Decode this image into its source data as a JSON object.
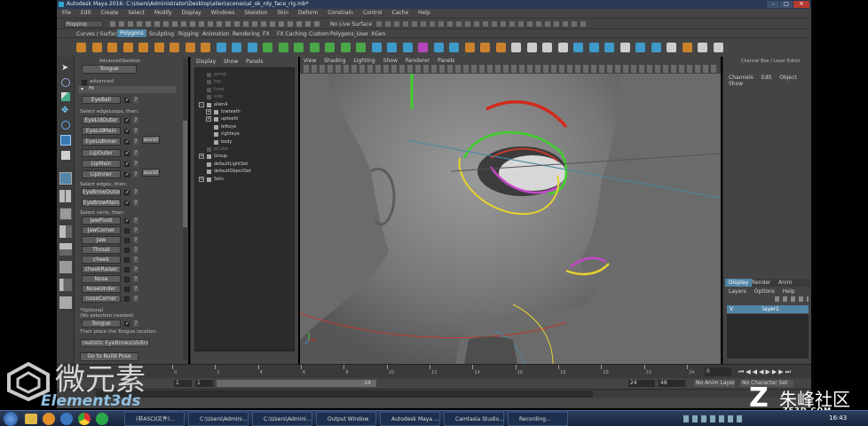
{
  "window": {
    "title": "Autodesk Maya 2016: C:\\Users\\Administrator\\Desktop\\alien\\scenes\\al_ok_rdy_face_rig.mb*"
  },
  "menubar": {
    "items": [
      "File",
      "Edit",
      "Create",
      "Select",
      "Modify",
      "Display",
      "Windows",
      "Skeleton",
      "Skin",
      "Deform",
      "Constrain",
      "Control",
      "Cache",
      "Help"
    ]
  },
  "statusline": {
    "mode": "Rigging",
    "surface": "No Live Surface"
  },
  "shelf": {
    "tabs": [
      "Curves / Surfaces",
      "Polygons",
      "Sculpting",
      "Rigging",
      "Animation",
      "Rendering",
      "FX",
      "FX Caching",
      "Custom",
      "Polygons_User",
      "XGen"
    ],
    "active": "Polygons"
  },
  "asface": {
    "title": "AdvancedSkeleton",
    "top_button": "Tongue",
    "advanced_label": "advanced",
    "fit_label": "Fit",
    "eyeball": "EyeBall",
    "edgeloops_label": "Select edgeLoops, then:",
    "loops1": [
      "EyeLidOuter",
      "EyeLidMain",
      "EyeLidInner"
    ],
    "loops2": [
      "LipOuter",
      "LipMain",
      "LipInner"
    ],
    "assist": "assist",
    "edges_label": "Select edges, then:",
    "edges": [
      "EyeBrowOuter",
      "EyeBrowMain"
    ],
    "verts_label": "Select verts, then:",
    "verts": [
      "JawPivot",
      "JawCorner",
      "Jaw",
      "Throat",
      "cheek",
      "cheekRaiser",
      "Nose",
      "NoseUnder",
      "noseCorner"
    ],
    "optional_label": "*Optional",
    "no_selection": "(No selection needed)",
    "tongue": "Tongue",
    "then_place": "Then place the Tongue location",
    "dropdown": "realistic EyeBrows(sliding)",
    "build": "Go to Build Pose"
  },
  "outliner": {
    "menu": [
      "Display",
      "Show",
      "Panels"
    ],
    "items": [
      {
        "label": "persp",
        "indent": 0,
        "dim": true
      },
      {
        "label": "top",
        "indent": 0,
        "dim": true
      },
      {
        "label": "front",
        "indent": 0,
        "dim": true
      },
      {
        "label": "side",
        "indent": 0,
        "dim": true
      },
      {
        "label": "alien4",
        "indent": 0,
        "dim": false,
        "expand": "-"
      },
      {
        "label": "lowteeth",
        "indent": 1,
        "dim": false,
        "expand": "+"
      },
      {
        "label": "upteeth",
        "indent": 1,
        "dim": false,
        "expand": "+"
      },
      {
        "label": "lefteye",
        "indent": 1,
        "dim": false
      },
      {
        "label": "righteye",
        "indent": 1,
        "dim": false
      },
      {
        "label": "body",
        "indent": 1,
        "dim": false
      },
      {
        "label": "pCube",
        "indent": 0,
        "dim": true
      },
      {
        "label": "Group",
        "indent": 0,
        "dim": false,
        "expand": "+"
      },
      {
        "label": "defaultLightSet",
        "indent": 0,
        "dim": false
      },
      {
        "label": "defaultObjectSet",
        "indent": 0,
        "dim": false
      },
      {
        "label": "Sets",
        "indent": 0,
        "dim": false,
        "expand": "+"
      }
    ]
  },
  "viewport": {
    "menu": [
      "View",
      "Shading",
      "Lighting",
      "Show",
      "Renderer",
      "Panels"
    ]
  },
  "channelbox": {
    "title": "Channel Box / Layer Editor",
    "menu": [
      "Channels",
      "Edit",
      "Object",
      "Show"
    ]
  },
  "layers": {
    "tabs": [
      "Display",
      "Render",
      "Anim"
    ],
    "menu": [
      "Layers",
      "Options",
      "Help"
    ],
    "layer_name": "layer1",
    "layer_v": "V"
  },
  "timeline": {
    "ticks": [
      "0",
      "2",
      "4",
      "6",
      "8",
      "10",
      "12",
      "14",
      "16",
      "18",
      "20",
      "22",
      "24"
    ],
    "current": "0"
  },
  "range": {
    "start": "1",
    "inner_start": "1",
    "inner_end": "24",
    "end": "24",
    "end2": "48",
    "anim_layer": "No Anim Layer",
    "char_set": "No Character Set"
  },
  "watermark": {
    "left_cn": "微元素",
    "left_en": "Element3ds",
    "right_cn": "朱峰社区",
    "right_url": "ZF3D.COM"
  },
  "taskbar": {
    "items": [
      "(非ASCII文件)...",
      "C:\\Users\\Admini...",
      "C:\\Users\\Admini...",
      "Output Window",
      "Autodesk Maya ...",
      "Camtasia Studio...",
      "Recording..."
    ],
    "time": "16:43"
  },
  "colors": {
    "maya_bg": "#444444",
    "viewport_bg": "#6b6b6b",
    "selection_blue": "#5285a6",
    "red": "#d12a1c",
    "green": "#3fcf2b",
    "yellow": "#e8d22f",
    "magenta": "#c246c8"
  }
}
